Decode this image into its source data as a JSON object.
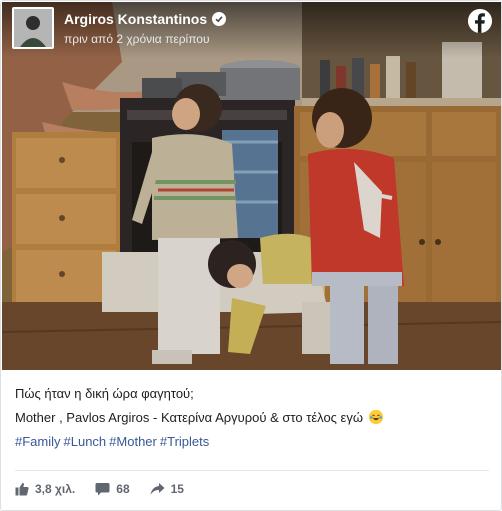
{
  "post": {
    "author_name": "Argiros Konstantinos",
    "timestamp": "πριν από 2 χρόνια περίπου",
    "caption_line1": "Πώς ήταν η δική ώρα φαγητού;",
    "caption_line2": "Mother , Pavlos Argiros - Κατερίνα Αργυρού & στο τέλος εγώ",
    "hashtags": [
      "#Family",
      "#Lunch",
      "#Mother",
      "#Triplets"
    ]
  },
  "stats": {
    "likes": "3,8 χιλ.",
    "comments": "68",
    "shares": "15"
  },
  "colors": {
    "link": "#385898",
    "meta_text": "#606770"
  },
  "icons": {
    "brand": "facebook-logo-icon",
    "verified": "verified-check-icon",
    "like": "thumbs-up-icon",
    "comment": "comment-bubble-icon",
    "share": "share-arrow-icon",
    "emoji": "laughing-tears-emoji-icon"
  }
}
